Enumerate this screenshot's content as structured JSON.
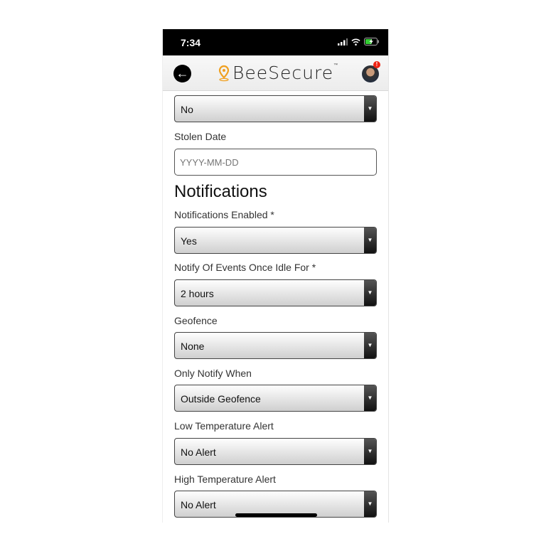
{
  "status_bar": {
    "time": "7:34"
  },
  "header": {
    "back_icon": "arrow-left-circle",
    "brand": "BeeSecure",
    "trademark": "™",
    "alert_badge": "!"
  },
  "form": {
    "stolen_select_value": "No",
    "stolen_date_label": "Stolen Date",
    "stolen_date_placeholder": "YYYY-MM-DD",
    "notifications_heading": "Notifications",
    "fields": [
      {
        "label": "Notifications Enabled *",
        "value": "Yes"
      },
      {
        "label": "Notify Of Events Once Idle For *",
        "value": "2 hours"
      },
      {
        "label": "Geofence",
        "value": "None"
      },
      {
        "label": "Only Notify When",
        "value": "Outside Geofence"
      },
      {
        "label": "Low Temperature Alert",
        "value": "No Alert"
      },
      {
        "label": "High Temperature Alert",
        "value": "No Alert"
      }
    ]
  },
  "colors": {
    "logo_pin": "#f0a020",
    "badge": "#e21111"
  }
}
